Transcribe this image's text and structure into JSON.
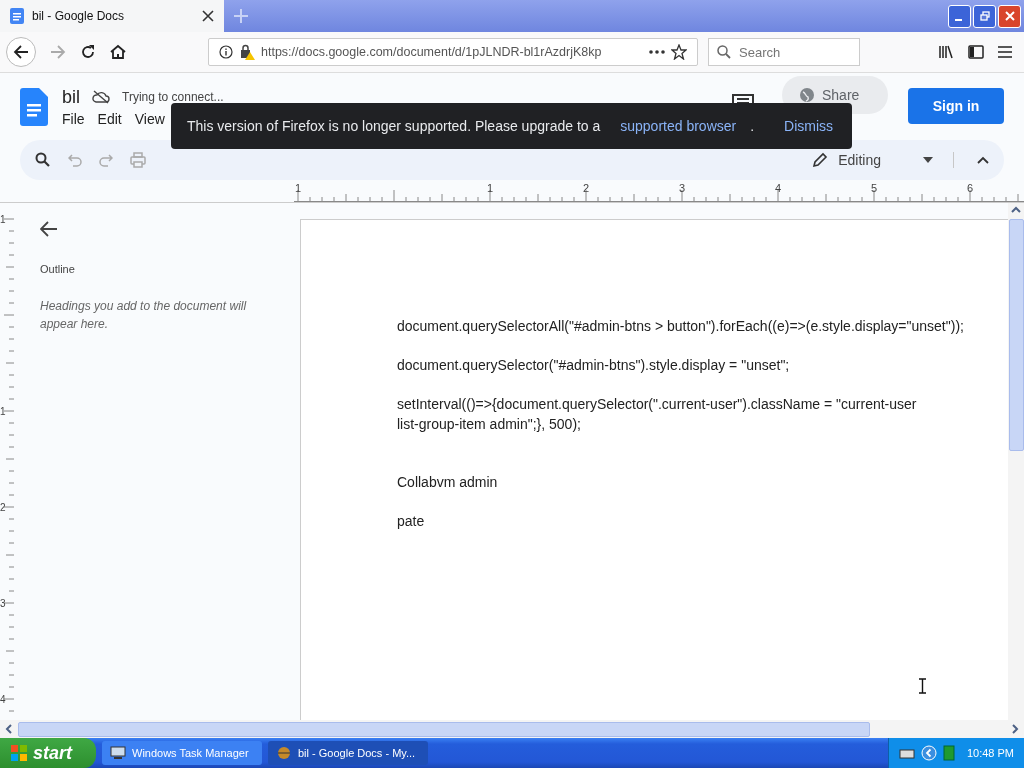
{
  "browser": {
    "tab": {
      "title": "bil - Google Docs"
    },
    "url": "https://docs.google.com/document/d/1pJLNDR-bl1rAzdrjK8kp",
    "search": {
      "placeholder": "Search"
    }
  },
  "docs": {
    "title": "bil",
    "status": "Trying to connect...",
    "menu": [
      "File",
      "Edit",
      "View"
    ],
    "share": "Share",
    "sign_in": "Sign in",
    "mode": "Editing"
  },
  "toast": {
    "message": "This version of Firefox is no longer supported. Please upgrade to a",
    "link": "supported browser",
    "period": ".",
    "dismiss": "Dismiss"
  },
  "ruler": {
    "labels": [
      "1",
      "1",
      "2",
      "3",
      "4",
      "5",
      "6"
    ]
  },
  "vertical_ruler": {
    "labels": [
      "1",
      "1",
      "2",
      "3",
      "4"
    ]
  },
  "outline": {
    "title": "Outline",
    "hint": "Headings you add to the document will appear here."
  },
  "document": {
    "paragraphs": [
      "document.querySelectorAll(\"#admin-btns > button\").forEach((e)=>(e.style.display=\"unset\"));",
      "document.querySelector(\"#admin-btns\").style.display = \"unset\";",
      "setInterval(()=>{document.querySelector(\".current-user\").className = \"current-user list-group-item admin\";}, 500);",
      "Collabvm admin",
      "pate"
    ]
  },
  "taskbar": {
    "start": "start",
    "tasks": [
      {
        "label": "Windows Task Manager",
        "selected": false
      },
      {
        "label": "bil - Google Docs - My...",
        "selected": true
      }
    ],
    "clock": "10:48 PM"
  }
}
